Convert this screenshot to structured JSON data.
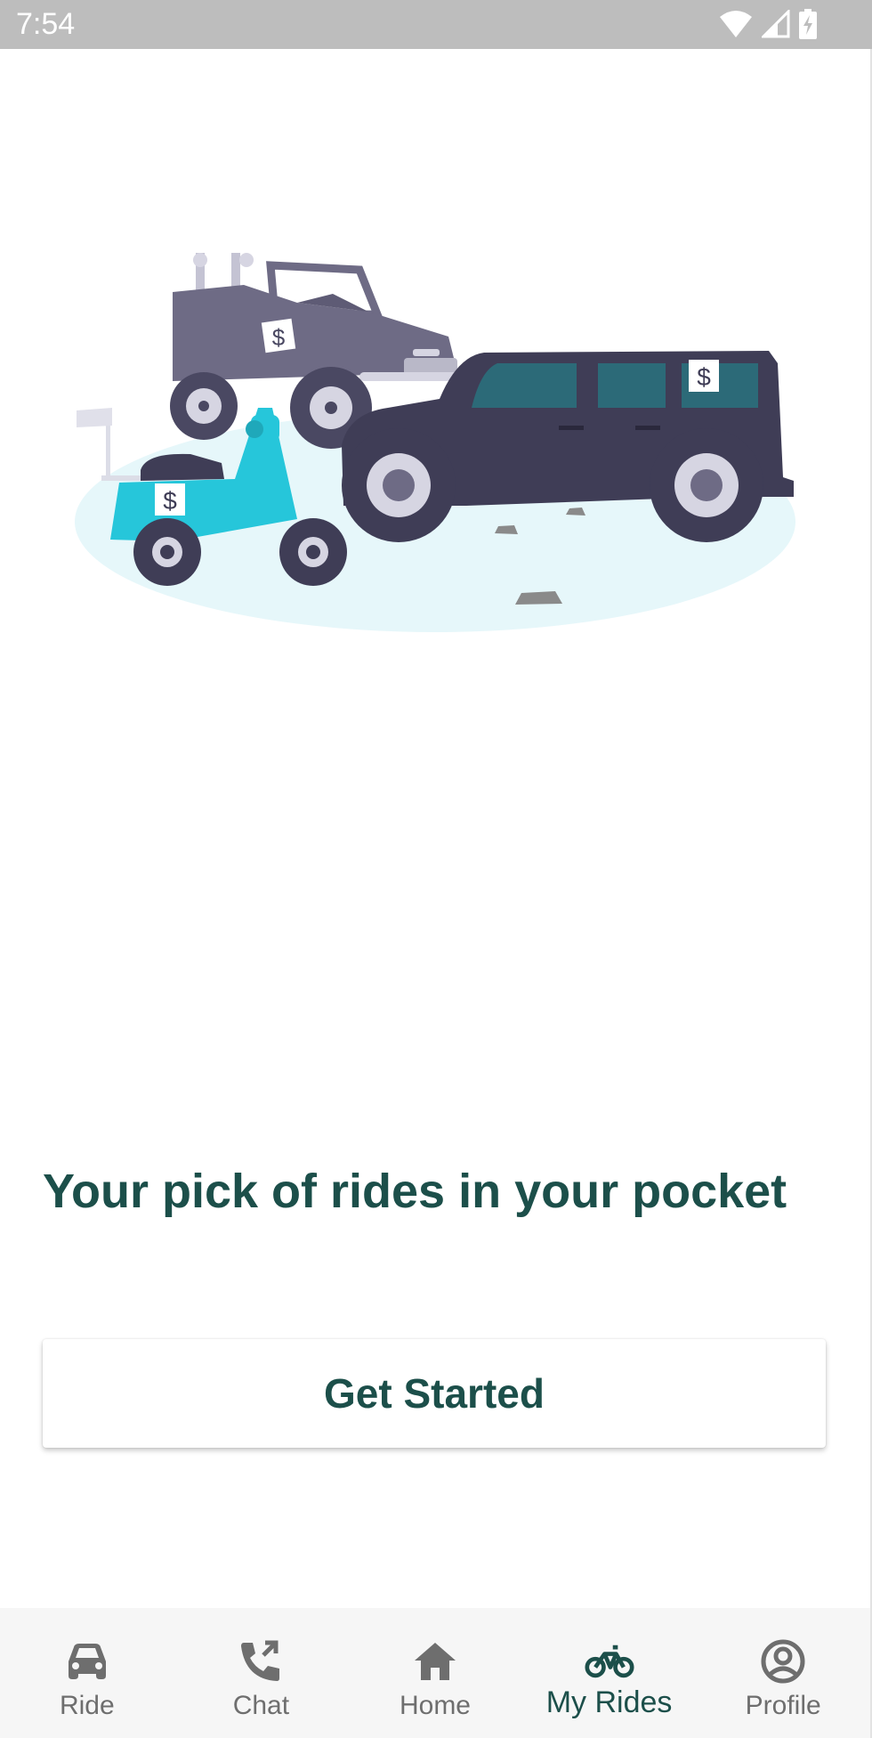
{
  "status_bar": {
    "time": "7:54",
    "icons": [
      "wifi-icon",
      "cell-signal-icon",
      "battery-charging-icon"
    ]
  },
  "onboarding": {
    "illustration": "vehicles-for-sale-illustration",
    "headline": "Your pick of rides in your pocket",
    "cta_label": "Get Started"
  },
  "bottom_nav": {
    "items": [
      {
        "label": "Ride",
        "icon": "car-icon",
        "active": false
      },
      {
        "label": "Chat",
        "icon": "phone-forward-icon",
        "active": false
      },
      {
        "label": "Home",
        "icon": "home-icon",
        "active": false
      },
      {
        "label": "My Rides",
        "icon": "bicycle-icon",
        "active": true
      },
      {
        "label": "Profile",
        "icon": "account-circle-icon",
        "active": false
      }
    ]
  },
  "colors": {
    "accent": "#1c4f4a",
    "nav_inactive": "#6e6e6e",
    "status_bar": "#bdbdbd",
    "scooter": "#26c6da",
    "suv": "#3f3d56",
    "jeep": "#6e6b85",
    "ground": "#e6f7fa"
  }
}
